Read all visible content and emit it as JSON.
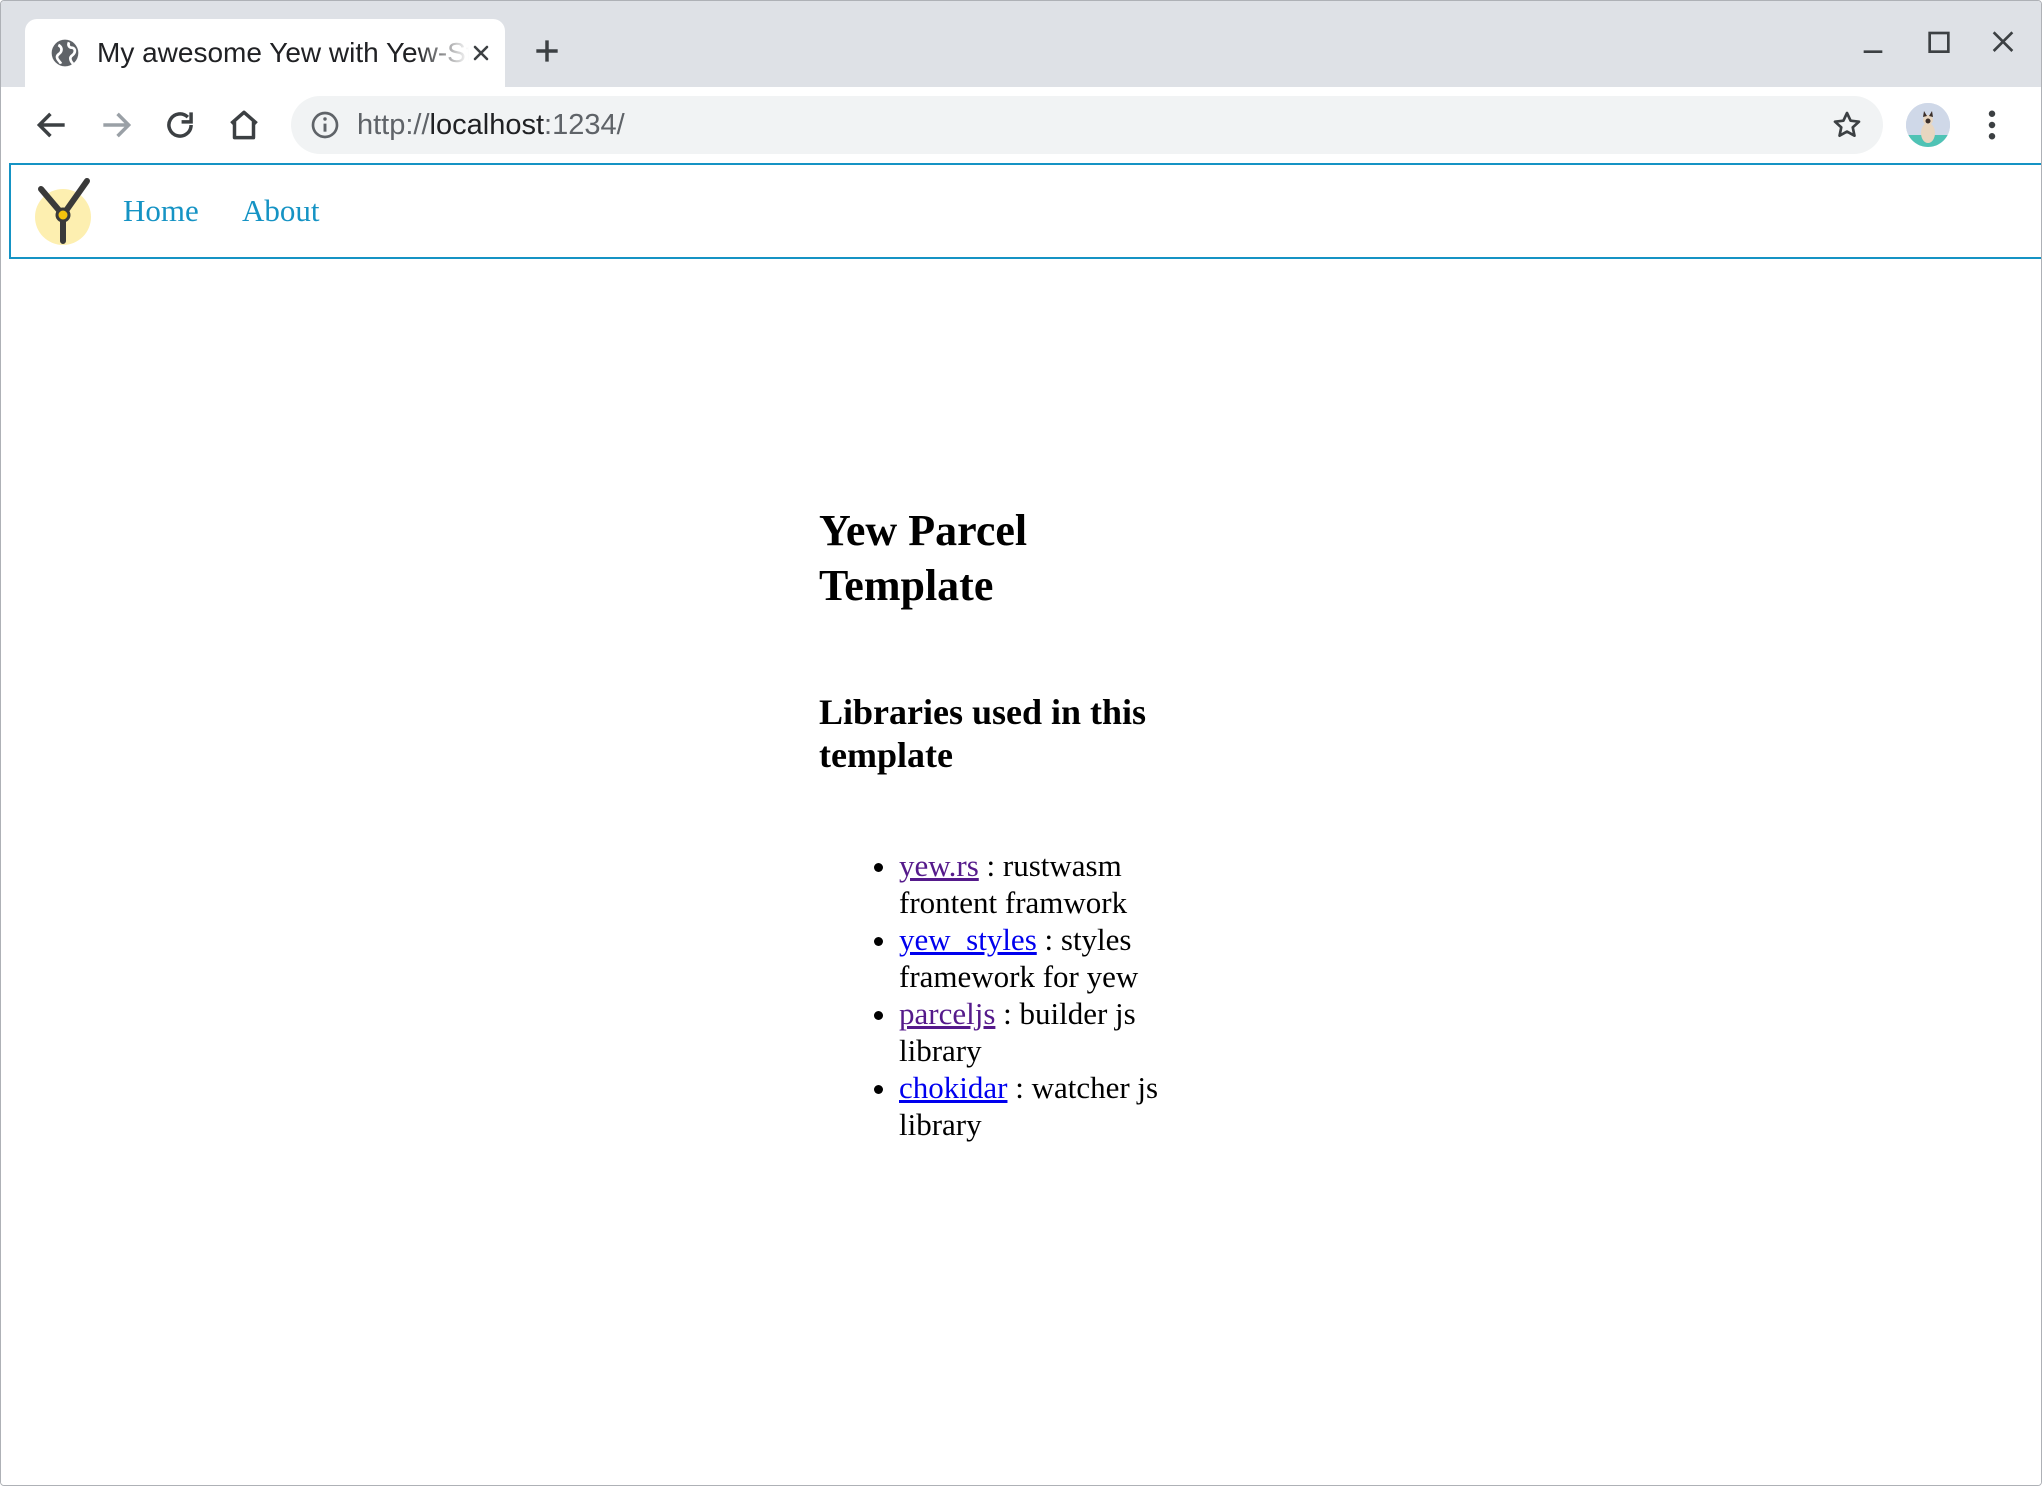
{
  "browser": {
    "tab_title": "My awesome Yew with Yew-Styles and Parcel application!",
    "url_scheme": "http://",
    "url_host": "localhost",
    "url_rest": ":1234/"
  },
  "navbar": {
    "home_label": "Home",
    "about_label": "About"
  },
  "page": {
    "title": "Yew Parcel Template",
    "subtitle": "Libraries used in this template",
    "libraries": [
      {
        "name": "yew.rs",
        "description": " : rustwasm frontent framwork",
        "visited": true
      },
      {
        "name": "yew_styles",
        "description": " : styles framework for yew",
        "visited": false
      },
      {
        "name": "parceljs",
        "description": " : builder js library",
        "visited": true
      },
      {
        "name": "chokidar",
        "description": " : watcher js library",
        "visited": false
      }
    ]
  },
  "colors": {
    "navbar_accent": "#1593c4",
    "visited_link": "#551a8b",
    "unvisited_link": "#0000ee",
    "logo_circle": "#fdefb0",
    "logo_stroke": "#3a3a3a",
    "logo_dot": "#f4c20d"
  },
  "icons": {
    "favicon": "globe-icon",
    "close": "close-icon",
    "new_tab": "plus-icon",
    "back": "arrow-left-icon",
    "forward": "arrow-right-icon",
    "reload": "reload-icon",
    "home": "home-icon",
    "info": "info-icon",
    "bookmark": "star-icon",
    "menu": "kebab-menu-icon"
  }
}
